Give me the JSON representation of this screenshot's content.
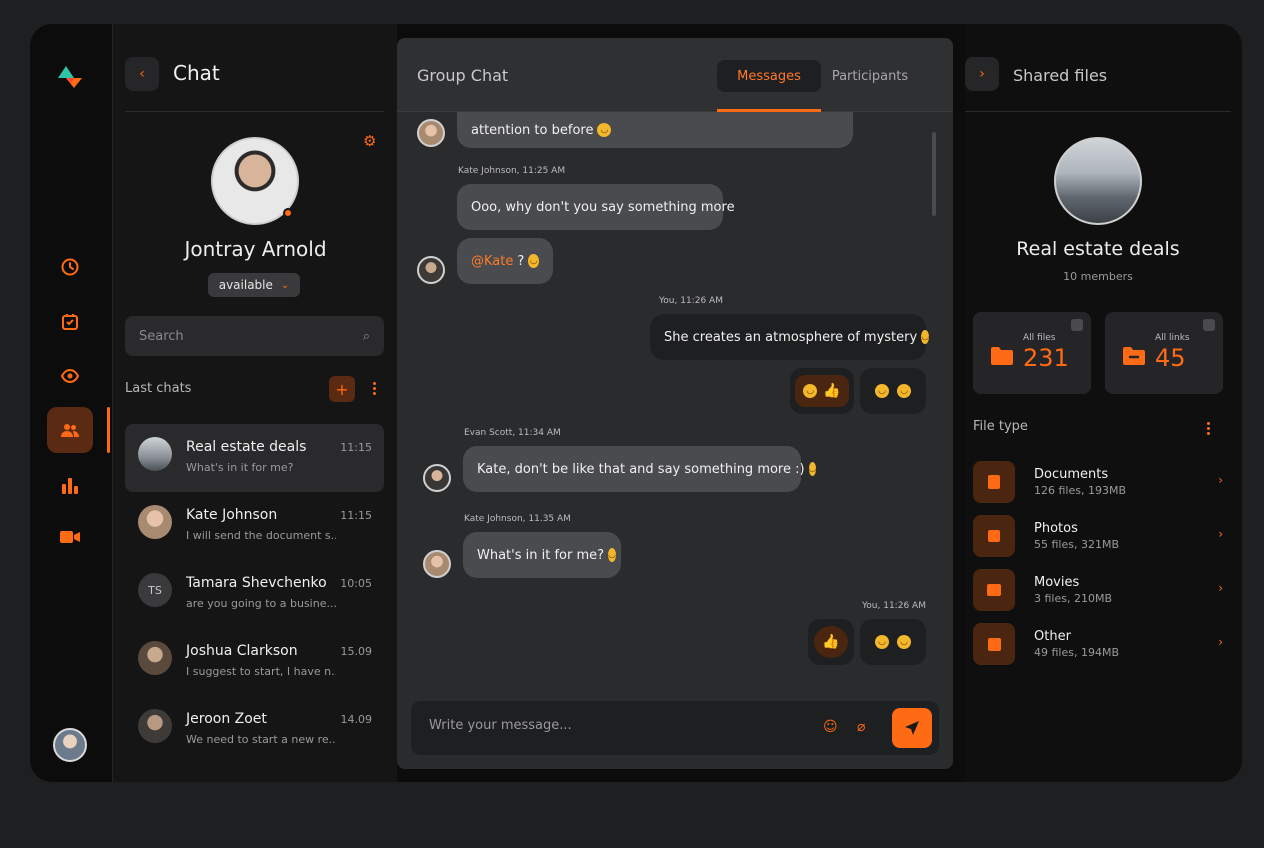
{
  "sidebar": {
    "title": "Chat",
    "profile": {
      "name": "Jontray Arnold",
      "status": "available"
    },
    "search_placeholder": "Search",
    "last_chats_label": "Last chats",
    "chats": [
      {
        "name": "Real estate deals",
        "preview": "What's in it for me?",
        "time": "11:15",
        "active": true
      },
      {
        "name": "Kate Johnson",
        "preview": "I will send the document s...",
        "time": "11:15"
      },
      {
        "name": "Tamara Shevchenko",
        "preview": "are you going to a busine...",
        "time": "10:05",
        "initials": "TS"
      },
      {
        "name": "Joshua Clarkson",
        "preview": "I suggest to start, I have n...",
        "time": "15.09"
      },
      {
        "name": "Jeroon Zoet",
        "preview": "We need to start a new re...",
        "time": "14.09"
      }
    ]
  },
  "center": {
    "title": "Group Chat",
    "tabs": {
      "messages": "Messages",
      "participants": "Participants"
    },
    "messages": {
      "m1_text": "attention to before",
      "m2_meta": "Kate Johnson, 11:25 AM",
      "m2_text": "Ooo, why don't you say something more",
      "m3_mention": "@Kate",
      "m3_text": "?",
      "m4_meta": "You, 11:26 AM",
      "m4_text": "She creates an atmosphere of mystery",
      "m5_meta": "Evan Scott, 11:34 AM",
      "m5_text": "Kate, don't be like that and say something more :)",
      "m6_meta": "Kate Johnson, 11.35 AM",
      "m6_text": "What's in it for me?",
      "m7_meta": "You, 11:26 AM"
    },
    "composer_placeholder": "Write your message..."
  },
  "right": {
    "title": "Shared files",
    "group_name": "Real estate deals",
    "members": "10 members",
    "stats": [
      {
        "label": "All files",
        "value": "231"
      },
      {
        "label": "All links",
        "value": "45"
      }
    ],
    "file_type_label": "File type",
    "file_types": [
      {
        "name": "Documents",
        "meta": "126 files, 193MB"
      },
      {
        "name": "Photos",
        "meta": "55 files, 321MB"
      },
      {
        "name": "Movies",
        "meta": "3 files, 210MB"
      },
      {
        "name": "Other",
        "meta": "49 files, 194MB"
      }
    ]
  },
  "colors": {
    "accent": "#ff6a14",
    "background": "#0c0c0d",
    "bubble": "#4a4b4e"
  }
}
